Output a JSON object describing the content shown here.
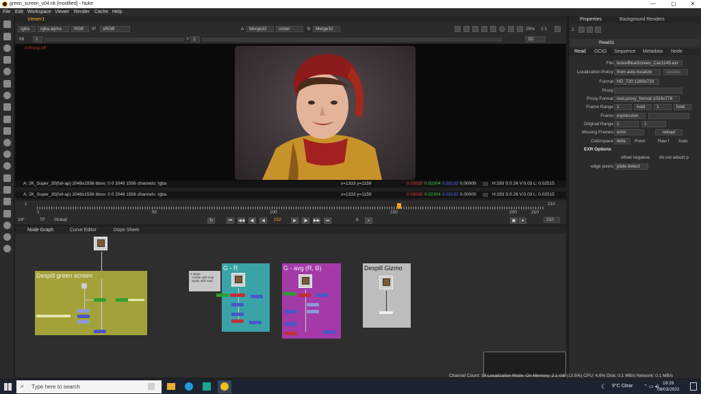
{
  "window": {
    "title": "green_screen_v04.nk [modified] - Nuke",
    "minimize": "—",
    "maximize": "▢",
    "close": "✕"
  },
  "menu": [
    "File",
    "Edit",
    "Workspace",
    "Viewer",
    "Render",
    "Cache",
    "Help"
  ],
  "viewer": {
    "tab_label": "Viewer1",
    "channels": "rgba",
    "alpha": "rgba.alpha",
    "colorspace_mode": "RGB",
    "ip": "IP",
    "display": "sRGB",
    "a_label": "A",
    "a_input": "Merge32",
    "composite": "under",
    "b_label": "B",
    "b_input": "Merge32",
    "zoom": "25%",
    "ratio": "1:1",
    "view_mode": "2D",
    "fstop": "f/8",
    "frame_inc": "1",
    "y_label": "Y",
    "y_value": "1",
    "proxy_text": "o:Proxy off",
    "info_line_1": "A:   2K_Super_35(full-ap) 2048x1556  bbox: 0 0 2048 1556 channels: rgba",
    "coords_1": "x=1333 y=1159",
    "info_line_2": "A:   2K_Super_35(full-ap) 2048x1556  bbox: 0 0 2048 1556 channels: rgba",
    "coords_2": "x=1333 y=1159",
    "r_val": "0.03035",
    "g_val": "0.02304",
    "b_val": "0.03132",
    "a_val": "0.00000",
    "hsv": "H:293 S:0.26 V:0.03  L: 0.02515"
  },
  "timeline": {
    "ticks": [
      "1",
      "50",
      "100",
      "150",
      "200",
      "210"
    ],
    "start": "1",
    "end": "210",
    "current_frame": "152",
    "fps": "24*",
    "tf": "TF",
    "scope": "Global",
    "step": "8",
    "end_field": "210"
  },
  "nodegraph": {
    "tabs": [
      "Node Graph",
      "Curve Editor",
      "Dope Sheet"
    ],
    "backdrops": {
      "despill_green": "Despill green screen",
      "g_r": "G - R",
      "g_avg": "G - avg (R, B)",
      "gizmo": "Despill Gizmo"
    },
    "note": "2 steps:\n- create spill map\n- apply spill map"
  },
  "properties": {
    "tabs": [
      "Properties",
      "Background Renders"
    ],
    "count": "1",
    "node_name": "Read11",
    "sub_tabs": [
      "Read",
      "OCIO",
      "Sequence",
      "Metadata",
      "Node"
    ],
    "file": "tures/BlueScreen_Cac1145.exr",
    "localization_policy": "from auto-localize",
    "update_btn": "Update",
    "format": "HD_720 1280x720",
    "proxy": "",
    "proxy_format": "root.proxy_format 1024x778",
    "frame_range_start": "1",
    "frame_range_start_mode": "hold",
    "frame_range_end": "1",
    "frame_range_end_mode": "hold",
    "frame_mode": "expression",
    "original_range_start": "1",
    "original_range_end": "1",
    "missing_frames": "error",
    "reload_btn": "reload",
    "colorspace": "defa",
    "premultiplied": "Prem",
    "raw": "Raw I",
    "auto_alpha": "Auto",
    "exr_header": "EXR Options",
    "offset_negative": "offset negative",
    "do_not_attach": "do not attach p",
    "edge_pixels": "plate detect",
    "labels": {
      "file": "File",
      "localization_policy": "Localization Policy",
      "format": "Format",
      "proxy": "Proxy",
      "proxy_format": "Proxy Format",
      "frame_range": "Frame Range",
      "frame": "Frame",
      "original_range": "Original Range",
      "missing_frames": "Missing Frames",
      "colorspace": "Colorspace",
      "edge_pixels": "edge pixels"
    }
  },
  "status": "Channel Count: 19 Localization Mode: On Memory: 2.1 GB (13.5%) CPU: 4.6% Disk: 0.1 MB/s Network: 0.1 MB/s",
  "taskbar": {
    "search_placeholder": "Type here to search",
    "weather": "9°C  Clear",
    "time": "19:29",
    "date": "08/03/2022"
  }
}
